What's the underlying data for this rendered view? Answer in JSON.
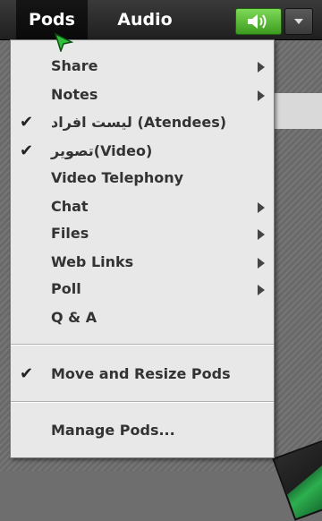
{
  "menubar": {
    "tabs": [
      {
        "label": "Pods"
      },
      {
        "label": "Audio"
      }
    ],
    "audio_button_icon": "speaker-icon",
    "audio_dropdown_icon": "chevron-down-icon",
    "accent_green": "#5cc13a"
  },
  "menu": {
    "items": [
      {
        "label": "Share",
        "submenu": true,
        "checked": false
      },
      {
        "label": "Notes",
        "submenu": true,
        "checked": false
      },
      {
        "label": "لیست افراد (Atendees)",
        "submenu": false,
        "checked": true
      },
      {
        "label": "تصویر(Video)",
        "submenu": false,
        "checked": true
      },
      {
        "label": "Video Telephony",
        "submenu": false,
        "checked": false
      },
      {
        "label": "Chat",
        "submenu": true,
        "checked": false
      },
      {
        "label": "Files",
        "submenu": true,
        "checked": false
      },
      {
        "label": "Web Links",
        "submenu": true,
        "checked": false
      },
      {
        "label": "Poll",
        "submenu": true,
        "checked": false
      },
      {
        "label": "Q & A",
        "submenu": false,
        "checked": false
      },
      {
        "label": "Move and Resize Pods",
        "submenu": false,
        "checked": true
      },
      {
        "label": "Manage Pods...",
        "submenu": false,
        "checked": false
      }
    ],
    "check_glyph": "✔"
  }
}
